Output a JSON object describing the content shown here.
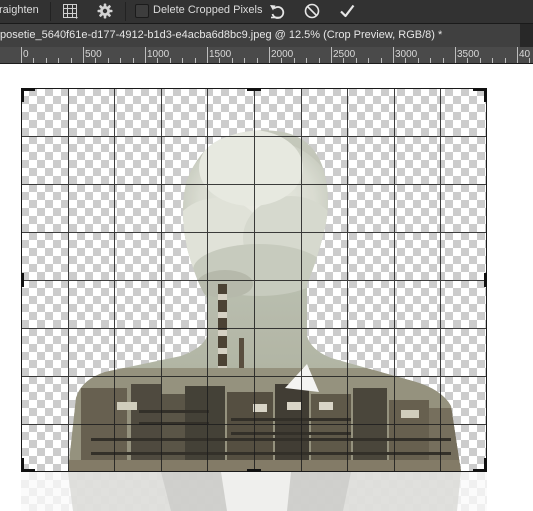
{
  "options_bar": {
    "straighten_label": "raighten",
    "delete_cropped_label": "Delete Cropped Pixels",
    "delete_cropped_checked": false,
    "icons": [
      "overlay-grid-icon",
      "settings-gear-icon",
      "reset-icon",
      "cancel-icon",
      "commit-icon"
    ]
  },
  "document": {
    "tab_title": "posetie_5640f61e-d177-4912-b1d3-e4acba6d8bc9.jpeg @ 12.5% (Crop Preview, RGB/8) *"
  },
  "ruler": {
    "labels": [
      "0",
      "500",
      "1000",
      "1500",
      "2000",
      "2500",
      "3000",
      "3500",
      "40"
    ]
  },
  "crop": {
    "mode": "Crop Preview",
    "overlay": "grid",
    "columns": 10,
    "rows": 8
  }
}
